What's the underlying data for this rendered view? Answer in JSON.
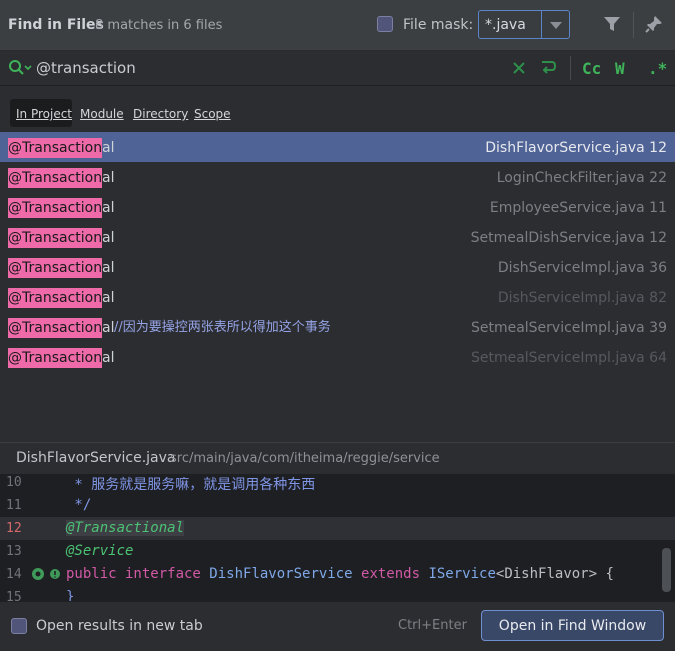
{
  "header": {
    "title": "Find in Files",
    "match_count": "8 matches in 6 files",
    "file_mask_label": "File mask:",
    "file_mask_value": "*.java",
    "file_mask_checked": true,
    "icons": [
      "filter-icon",
      "pin-icon"
    ]
  },
  "search": {
    "query": "@transaction",
    "options": [
      "Cc",
      "W",
      ".*"
    ],
    "icons": [
      "search-icon",
      "clear-icon",
      "replace-icon"
    ]
  },
  "scopes": [
    "In Project",
    "Module",
    "Directory",
    "Scope"
  ],
  "active_scope": "In Project",
  "results": [
    {
      "match": "@Transaction",
      "rest": "al",
      "comment": "",
      "file": "DishFlavorService.java 12",
      "selected": true
    },
    {
      "match": "@Transaction",
      "rest": "al",
      "comment": "",
      "file": "LoginCheckFilter.java 22"
    },
    {
      "match": "@Transaction",
      "rest": "al",
      "comment": "",
      "file": "EmployeeService.java 11"
    },
    {
      "match": "@Transaction",
      "rest": "al",
      "comment": "",
      "file": "SetmealDishService.java 12"
    },
    {
      "match": "@Transaction",
      "rest": "al",
      "comment": "",
      "file": "DishServiceImpl.java 36"
    },
    {
      "match": "@Transaction",
      "rest": "al",
      "comment": "",
      "file": "DishServiceImpl.java 82",
      "dim": true
    },
    {
      "match": "@Transaction",
      "rest": "al",
      "comment": "//因为要操控两张表所以得加这个事务",
      "file": "SetmealServiceImpl.java 39"
    },
    {
      "match": "@Transaction",
      "rest": "al",
      "comment": "",
      "file": "SetmealServiceImpl.java 64",
      "dim": true
    }
  ],
  "preview": {
    "file": "DishFlavorService.java",
    "path": "src/main/java/com/itheima/reggie/service",
    "lines": [
      {
        "num": "10",
        "text": " * 服务就是服务嘛，就是调用各种东西"
      },
      {
        "num": "11",
        "text": " */"
      },
      {
        "num": "12",
        "text": "@Transactional",
        "current": true
      },
      {
        "num": "13",
        "text": "@Service"
      },
      {
        "num": "14",
        "text": "public interface DishFlavorService extends IService<DishFlavor> {"
      },
      {
        "num": "15",
        "text": "}"
      }
    ]
  },
  "footer": {
    "new_tab_label": "Open results in new tab",
    "shortcut": "Ctrl+Enter",
    "open_button": "Open in Find Window"
  },
  "colors": {
    "accent": "#4f6396",
    "match_highlight": "#ef6aa9",
    "option_green": "#3fb35a"
  }
}
